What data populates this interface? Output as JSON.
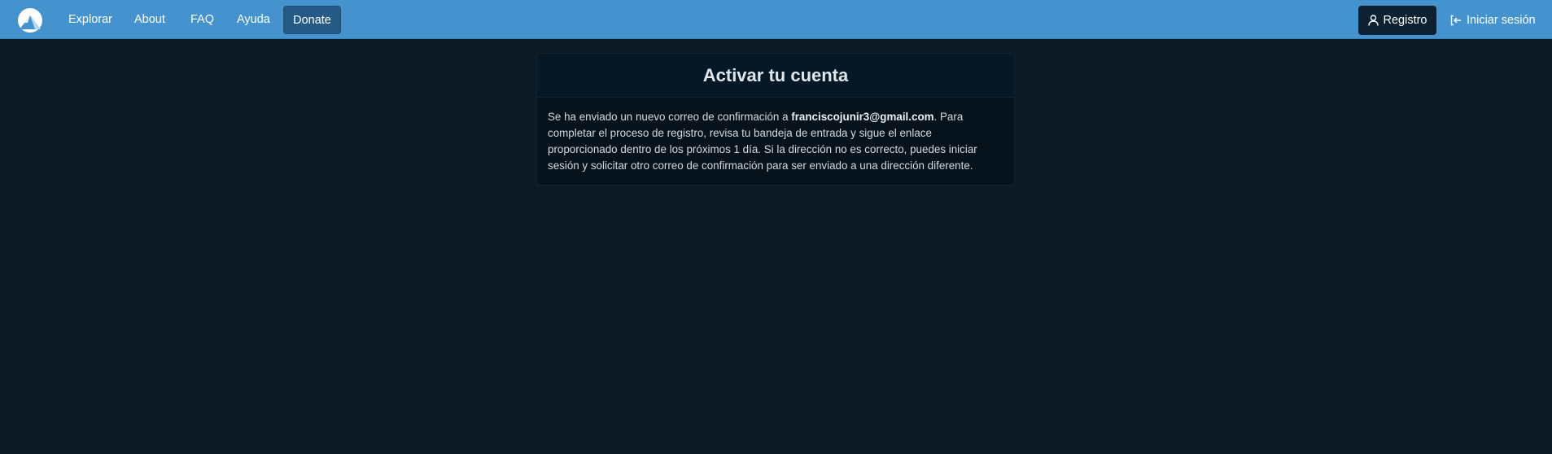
{
  "navbar": {
    "logo_icon": "mountain-logo-icon",
    "links": [
      {
        "label": "Explorar"
      },
      {
        "label": "About"
      },
      {
        "label": "FAQ"
      },
      {
        "label": "Ayuda"
      },
      {
        "label": "Donate"
      }
    ],
    "register_label": "Registro",
    "register_icon": "user-icon",
    "login_label": "Iniciar sesión",
    "login_icon": "sign-in-icon"
  },
  "card": {
    "title": "Activar tu cuenta",
    "message_before": "Se ha enviado un nuevo correo de confirmación a ",
    "email": "franciscojunir3@gmail.com",
    "message_after": ". Para completar el proceso de registro, revisa tu bandeja de entrada y sigue el enlace proporcionado dentro de los próximos 1 día. Si la dirección no es correcto, puedes iniciar sesión y solicitar otro correo de confirmación para ser enviado a una dirección diferente."
  },
  "colors": {
    "navbar": "#4493ce",
    "page_background": "#0d1a23",
    "card_background": "#07131c",
    "donate_button": "#245a85",
    "register_button": "#0d2131"
  }
}
